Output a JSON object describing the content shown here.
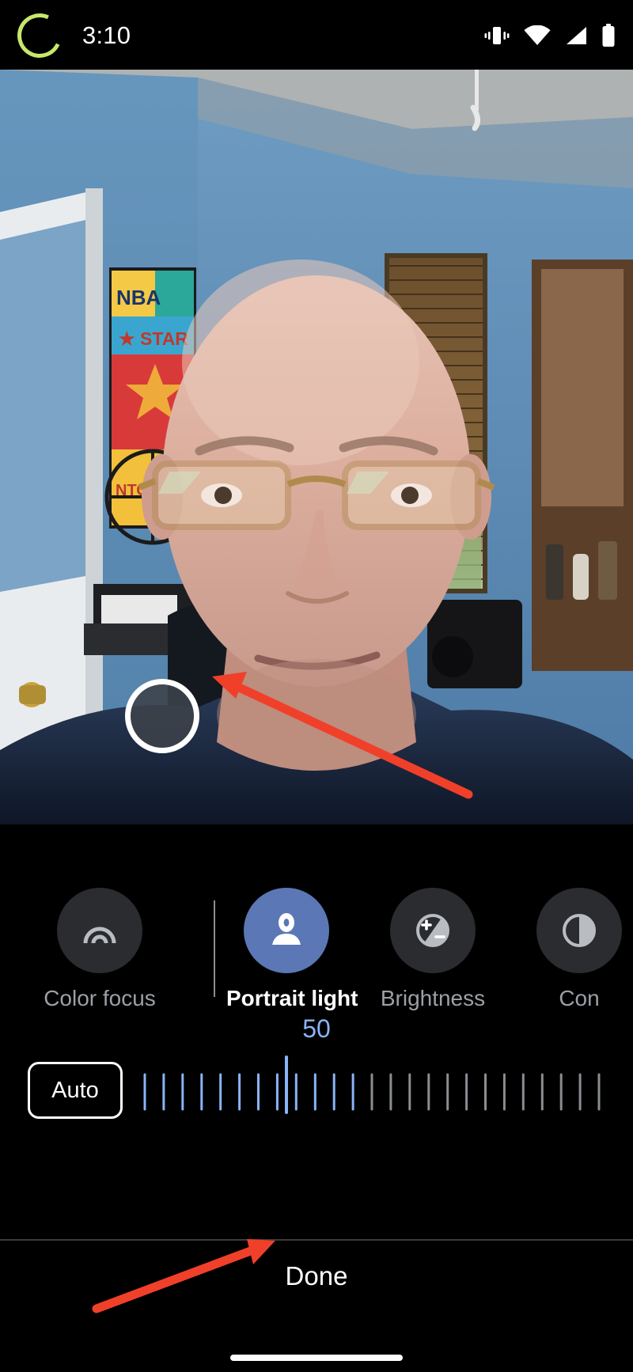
{
  "statusbar": {
    "time": "3:10",
    "recording_indicator": "camera-recording-ring",
    "icons": [
      "vibrate-icon",
      "wifi-icon",
      "signal-icon",
      "battery-icon"
    ],
    "ring_color": "#c6e86b"
  },
  "photo": {
    "description": "Portrait selfie of a bald man with glasses in a blue room",
    "focus_marker": "portrait-light-placement-marker"
  },
  "annotations": {
    "arrow_color": "#f0402a",
    "arrow_to_marker": "arrow-pointing-to-light-marker",
    "arrow_to_slider": "arrow-pointing-to-intensity-slider"
  },
  "editor": {
    "tools": [
      {
        "label": "Color focus",
        "icon": "color-focus-icon",
        "selected": false
      },
      {
        "label": "Portrait light",
        "icon": "portrait-light-icon",
        "selected": true
      },
      {
        "label": "Brightness",
        "icon": "brightness-icon",
        "selected": false
      },
      {
        "label": "Con",
        "icon": "contrast-icon",
        "selected": false
      }
    ],
    "slider": {
      "value": "50",
      "auto_label": "Auto",
      "accent_color": "#8ab4f8",
      "tick_count": 25,
      "active_ticks": 12
    },
    "done_label": "Done"
  }
}
